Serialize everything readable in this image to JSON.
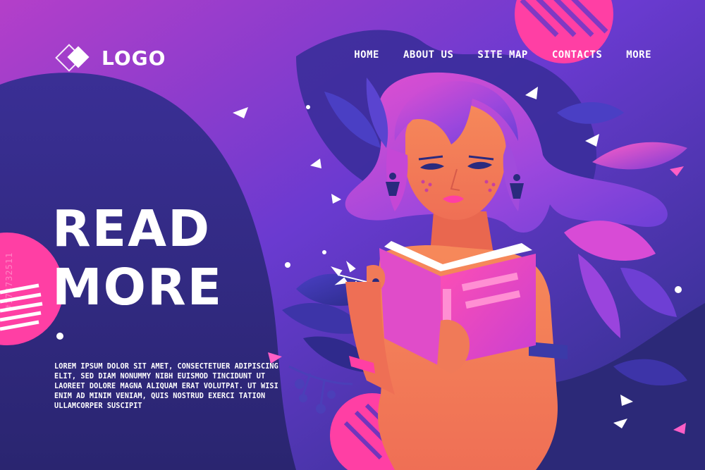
{
  "brand": {
    "logo_text": "LOGO"
  },
  "nav": {
    "items": [
      {
        "label": "HOME"
      },
      {
        "label": "ABOUT US"
      },
      {
        "label": "SITE MAP"
      },
      {
        "label": "CONTACTS"
      },
      {
        "label": "MORE"
      }
    ]
  },
  "hero": {
    "headline_line1": "READ",
    "headline_line2": "MORE",
    "body": "LOREM IPSUM DOLOR SIT AMET, CONSECTETUER ADIPISCING ELIT, SED DIAM NONUMMY NIBH EUISMOD TINCIDUNT UT LAOREET DOLORE MAGNA ALIQUAM ERAT VOLUTPAT. UT WISI ENIM AD MINIM VENIAM, QUIS NOSTRUD EXERCI TATION ULLAMCORPER SUSCIPIT"
  },
  "stock_id": "#174732511",
  "colors": {
    "accent_pink": "#ff3fa4",
    "dark_violet": "#2b2a7e",
    "purple": "#7c3bd0",
    "skin": "#f27b5a"
  }
}
